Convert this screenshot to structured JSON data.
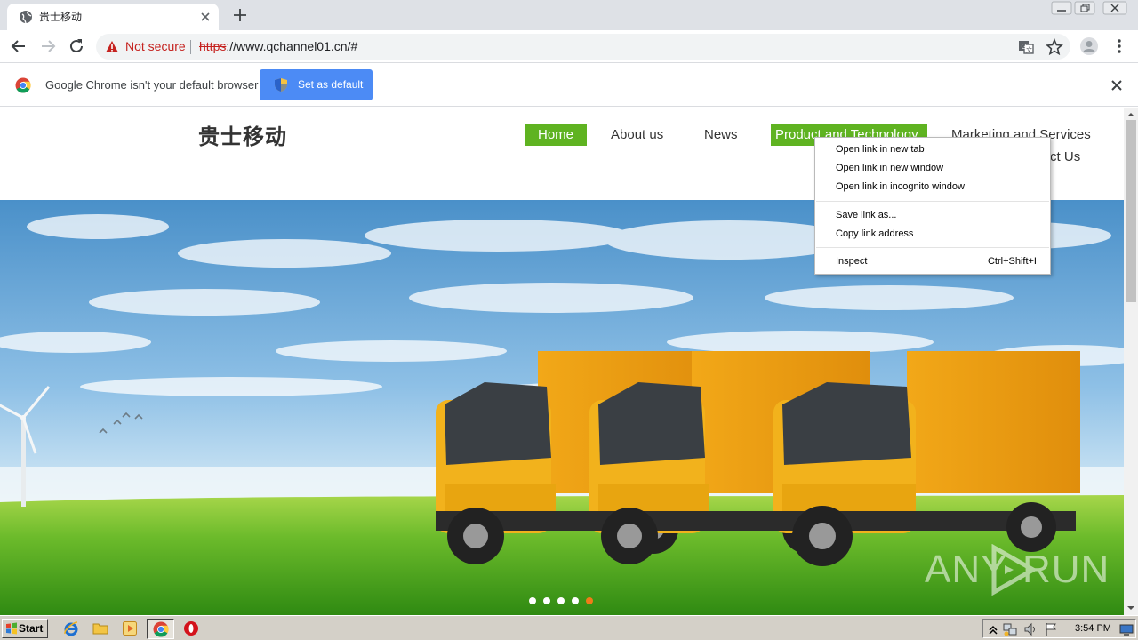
{
  "browser": {
    "tab": {
      "title": "贵士移动",
      "favicon": "globe-icon",
      "close_icon": "close-icon"
    },
    "new_tab_icon": "plus-icon",
    "window_controls": [
      "minimize-icon",
      "restore-icon",
      "close-icon"
    ],
    "toolbar": {
      "back_icon": "arrow-left-icon",
      "forward_icon": "arrow-right-icon",
      "reload_icon": "reload-icon",
      "security_label": "Not secure",
      "url_scheme": "https",
      "url_rest": "://www.qchannel01.cn/#",
      "translate_icon": "translate-icon",
      "bookmark_icon": "star-icon",
      "profile_icon": "avatar-icon",
      "menu_icon": "kebab-menu-icon"
    },
    "infobar": {
      "message": "Google Chrome isn't your default browser",
      "button_label": "Set as default",
      "button_color": "#4c8bf5"
    }
  },
  "site": {
    "logo_text": "贵士移动",
    "accent_color": "#5fb321",
    "nav": [
      {
        "label": "Home",
        "active": true
      },
      {
        "label": "About us",
        "active": false
      },
      {
        "label": "News",
        "active": false
      },
      {
        "label": "Product and Technology",
        "active": true
      },
      {
        "label": "Marketing and Services",
        "active": false
      },
      {
        "label": "Contact Us",
        "active": false
      }
    ],
    "slider": {
      "count": 5,
      "active_index": 4,
      "active_color": "#f07b18"
    }
  },
  "context_menu": {
    "groups": [
      [
        {
          "label": "Open link in new tab"
        },
        {
          "label": "Open link in new window"
        },
        {
          "label": "Open link in incognito window"
        }
      ],
      [
        {
          "label": "Save link as..."
        },
        {
          "label": "Copy link address"
        }
      ],
      [
        {
          "label": "Inspect",
          "shortcut": "Ctrl+Shift+I"
        }
      ]
    ]
  },
  "taskbar": {
    "start_label": "Start",
    "apps": [
      "internet-explorer-icon",
      "folder-icon",
      "media-player-icon",
      "chrome-icon",
      "opera-icon"
    ],
    "tray_icons": [
      "expand-tray-icon",
      "network-icon",
      "volume-icon",
      "flag-icon",
      "monitor-icon"
    ],
    "clock": "3:54 PM"
  },
  "watermark": {
    "left": "ANY",
    "right": "RUN"
  }
}
